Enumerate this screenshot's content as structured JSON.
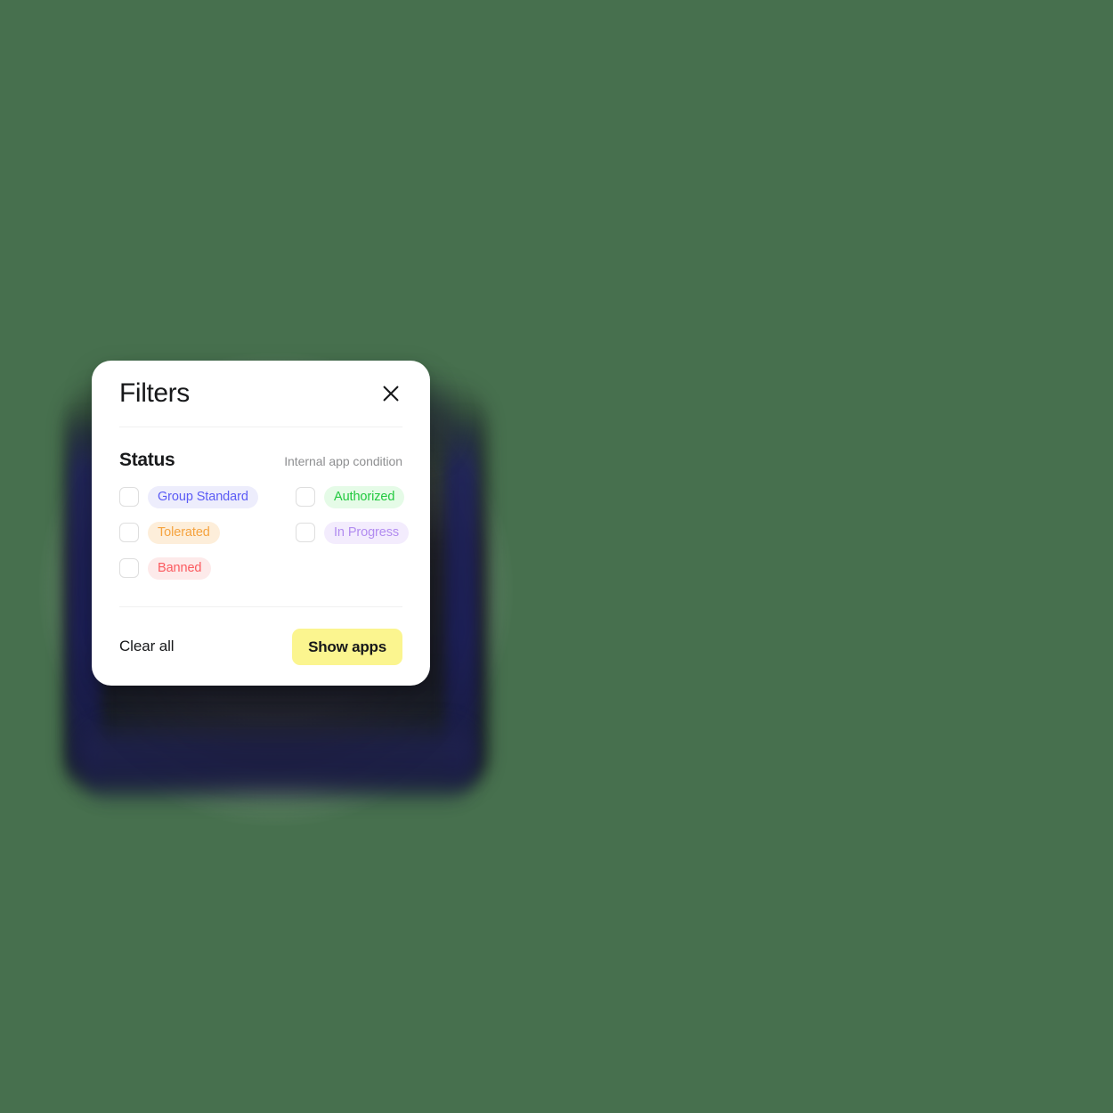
{
  "theme": {
    "page_background": "#47704e",
    "card_background": "#ffffff",
    "divider": "#f0f0f1",
    "accent_button": "#fbf58f",
    "text_primary": "#17181a",
    "text_muted": "#8e8f91",
    "checkbox_border": "#dedede"
  },
  "modal": {
    "title": "Filters",
    "close_icon": "close-icon",
    "section": {
      "title": "Status",
      "hint": "Internal app condition",
      "options": [
        {
          "label": "Group Standard",
          "checked": false,
          "text_color": "#5b5bf5",
          "chip_color": "#ededfc",
          "column": "left"
        },
        {
          "label": "Authorized",
          "checked": false,
          "text_color": "#22c93f",
          "chip_color": "#e5fbe7",
          "column": "right"
        },
        {
          "label": "Tolerated",
          "checked": false,
          "text_color": "#f5a33f",
          "chip_color": "#fdeeda",
          "column": "left"
        },
        {
          "label": "In Progress",
          "checked": false,
          "text_color": "#b28cf0",
          "chip_color": "#f3ecfd",
          "column": "right"
        },
        {
          "label": "Banned",
          "checked": false,
          "text_color": "#fb5a5f",
          "chip_color": "#fdeaea",
          "column": "left"
        }
      ]
    },
    "footer": {
      "clear_label": "Clear all",
      "submit_label": "Show apps"
    }
  }
}
